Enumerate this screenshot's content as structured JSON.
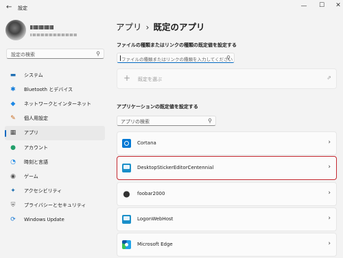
{
  "window": {
    "title": "設定",
    "back_icon": "back-arrow-icon",
    "minimize": "—",
    "maximize": "☐",
    "close": "✕"
  },
  "sidebar": {
    "search_placeholder": "設定の検索",
    "items": [
      {
        "label": "システム",
        "icon": "▬",
        "color": "#1f6fb3"
      },
      {
        "label": "Bluetooth とデバイス",
        "icon": "✱",
        "color": "#0f7ad9"
      },
      {
        "label": "ネットワークとインターネット",
        "icon": "◆",
        "color": "#1e88e5"
      },
      {
        "label": "個人用設定",
        "icon": "✎",
        "color": "#c96a1d"
      },
      {
        "label": "アプリ",
        "icon": "▦",
        "color": "#444444"
      },
      {
        "label": "アカウント",
        "icon": "●",
        "color": "#22a06b"
      },
      {
        "label": "時刻と言語",
        "icon": "◔",
        "color": "#1e88e5"
      },
      {
        "label": "ゲーム",
        "icon": "◉",
        "color": "#555555"
      },
      {
        "label": "アクセシビリティ",
        "icon": "✦",
        "color": "#1e6fb0"
      },
      {
        "label": "プライバシーとセキュリティ",
        "icon": "⛨",
        "color": "#6b6b6b"
      },
      {
        "label": "Windows Update",
        "icon": "⟳",
        "color": "#1677d4"
      }
    ],
    "selected_index": 4
  },
  "main": {
    "breadcrumb_parent": "アプリ",
    "breadcrumb_sep": "›",
    "breadcrumb_current": "既定のアプリ",
    "filetype_section_label": "ファイルの種類またはリンクの種類の既定値を設定する",
    "filetype_placeholder": "ファイルの種類またはリンクの種類を入力してください",
    "choose_default_label": "既定を選ぶ",
    "apps_section_label": "アプリケーションの既定値を設定する",
    "app_search_placeholder": "アプリの検索",
    "apps": [
      {
        "name": "Cortana",
        "icon": "cortana-icon"
      },
      {
        "name": "DesktopStickerEditorCentennial",
        "icon": "desktop-sticker-icon",
        "highlighted": true
      },
      {
        "name": "foobar2000",
        "icon": "alien-icon"
      },
      {
        "name": "LogonWebHost",
        "icon": "logon-web-host-icon"
      },
      {
        "name": "Microsoft Edge",
        "icon": "edge-icon"
      }
    ]
  },
  "colors": {
    "accent": "#0067c0",
    "highlight_border": "#c4262e"
  }
}
